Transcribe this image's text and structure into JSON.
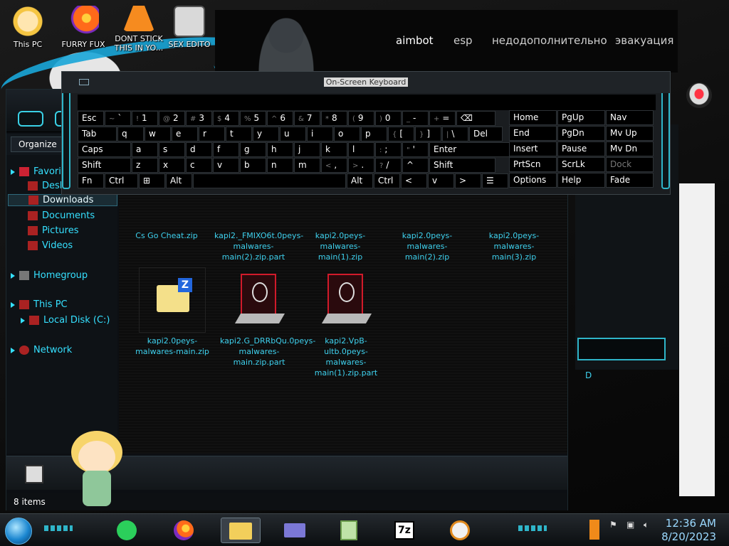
{
  "desktop": {
    "icons": [
      {
        "label": "This PC"
      },
      {
        "label": "FURRY FUX"
      },
      {
        "label": "DONT STICK THIS IN YO..."
      },
      {
        "label": "SEX EDITO"
      }
    ]
  },
  "cheat_menu": {
    "tabs": [
      "aimbot",
      "esp",
      "недодополнительно",
      "эвакуация"
    ],
    "active_tab": "aimbot"
  },
  "keyboard": {
    "title": "On-Screen Keyboard",
    "rows": [
      [
        {
          "l": "Esc"
        },
        {
          "l": "~",
          "s": "`"
        },
        {
          "l": "!",
          "s": "1"
        },
        {
          "l": "@",
          "s": "2"
        },
        {
          "l": "#",
          "s": "3"
        },
        {
          "l": "$",
          "s": "4"
        },
        {
          "l": "%",
          "s": "5"
        },
        {
          "l": "^",
          "s": "6"
        },
        {
          "l": "&",
          "s": "7"
        },
        {
          "l": "*",
          "s": "8"
        },
        {
          "l": "(",
          "s": "9"
        },
        {
          "l": ")",
          "s": "0"
        },
        {
          "l": "_",
          "s": "-"
        },
        {
          "l": "+",
          "s": "="
        },
        {
          "l": "⌫"
        }
      ],
      [
        {
          "l": "Tab"
        },
        {
          "l": "q"
        },
        {
          "l": "w"
        },
        {
          "l": "e"
        },
        {
          "l": "r"
        },
        {
          "l": "t"
        },
        {
          "l": "y"
        },
        {
          "l": "u"
        },
        {
          "l": "i"
        },
        {
          "l": "o"
        },
        {
          "l": "p"
        },
        {
          "l": "{",
          "s": "["
        },
        {
          "l": "}",
          "s": "]"
        },
        {
          "l": "|",
          "s": "\\"
        },
        {
          "l": "Del"
        }
      ],
      [
        {
          "l": "Caps"
        },
        {
          "l": "a"
        },
        {
          "l": "s"
        },
        {
          "l": "d"
        },
        {
          "l": "f"
        },
        {
          "l": "g"
        },
        {
          "l": "h"
        },
        {
          "l": "j"
        },
        {
          "l": "k"
        },
        {
          "l": "l"
        },
        {
          "l": ":",
          "s": ";"
        },
        {
          "l": "\"",
          "s": "'"
        },
        {
          "l": "Enter"
        }
      ],
      [
        {
          "l": "Shift"
        },
        {
          "l": "z"
        },
        {
          "l": "x"
        },
        {
          "l": "c"
        },
        {
          "l": "v"
        },
        {
          "l": "b"
        },
        {
          "l": "n"
        },
        {
          "l": "m"
        },
        {
          "l": "<",
          "s": ","
        },
        {
          "l": ">",
          "s": "."
        },
        {
          "l": "?",
          "s": "/"
        },
        {
          "l": "^"
        },
        {
          "l": "Shift"
        }
      ],
      [
        {
          "l": "Fn"
        },
        {
          "l": "Ctrl"
        },
        {
          "l": "⊞"
        },
        {
          "l": "Alt"
        },
        {
          "l": ""
        },
        {
          "l": "Alt"
        },
        {
          "l": "Ctrl"
        },
        {
          "l": "<"
        },
        {
          "l": "v"
        },
        {
          "l": ">"
        },
        {
          "l": "☰"
        }
      ]
    ],
    "nav_rows": [
      [
        "Home",
        "PgUp",
        "Nav"
      ],
      [
        "End",
        "PgDn",
        "Mv Up"
      ],
      [
        "Insert",
        "Pause",
        "Mv Dn"
      ],
      [
        "PrtScn",
        "ScrLk",
        "Dock"
      ],
      [
        "Options",
        "Help",
        "Fade"
      ]
    ]
  },
  "explorer": {
    "organize_label": "Organize",
    "nav": {
      "favorites": "Favorites",
      "desktop": "Desktop",
      "downloads": "Downloads",
      "documents": "Documents",
      "pictures": "Pictures",
      "videos": "Videos",
      "homegroup": "Homegroup",
      "this_pc": "This PC",
      "local_disk": "Local Disk (C:)",
      "network": "Network"
    },
    "files": [
      {
        "name": "Cs Go Cheat.zip",
        "kind": "zip"
      },
      {
        "name": "kapi2._FMIXO6t.0peys-malwares-main(2).zip.part",
        "kind": "part"
      },
      {
        "name": "kapi2.0peys-malwares-main(1).zip",
        "kind": "zip"
      },
      {
        "name": "kapi2.0peys-malwares-main(2).zip",
        "kind": "zip"
      },
      {
        "name": "kapi2.0peys-malwares-main(3).zip",
        "kind": "zip"
      },
      {
        "name": "kapi2.0peys-malwares-main.zip",
        "kind": "zip"
      },
      {
        "name": "kapi2.G_DRRbQu.0peys-malwares-main.zip.part",
        "kind": "part"
      },
      {
        "name": "kapi2.VpB-ultb.0peys-malwares-main(1).zip.part",
        "kind": "part"
      }
    ],
    "status": "8 items"
  },
  "right_window": {
    "label": "D"
  },
  "taskbar": {
    "time": "12:36 AM",
    "date": "8/20/2023",
    "apps": [
      "notes-app",
      "firefox",
      "file-explorer",
      "control-panel",
      "notepad-plus",
      "7zip",
      "counter-strike"
    ]
  }
}
